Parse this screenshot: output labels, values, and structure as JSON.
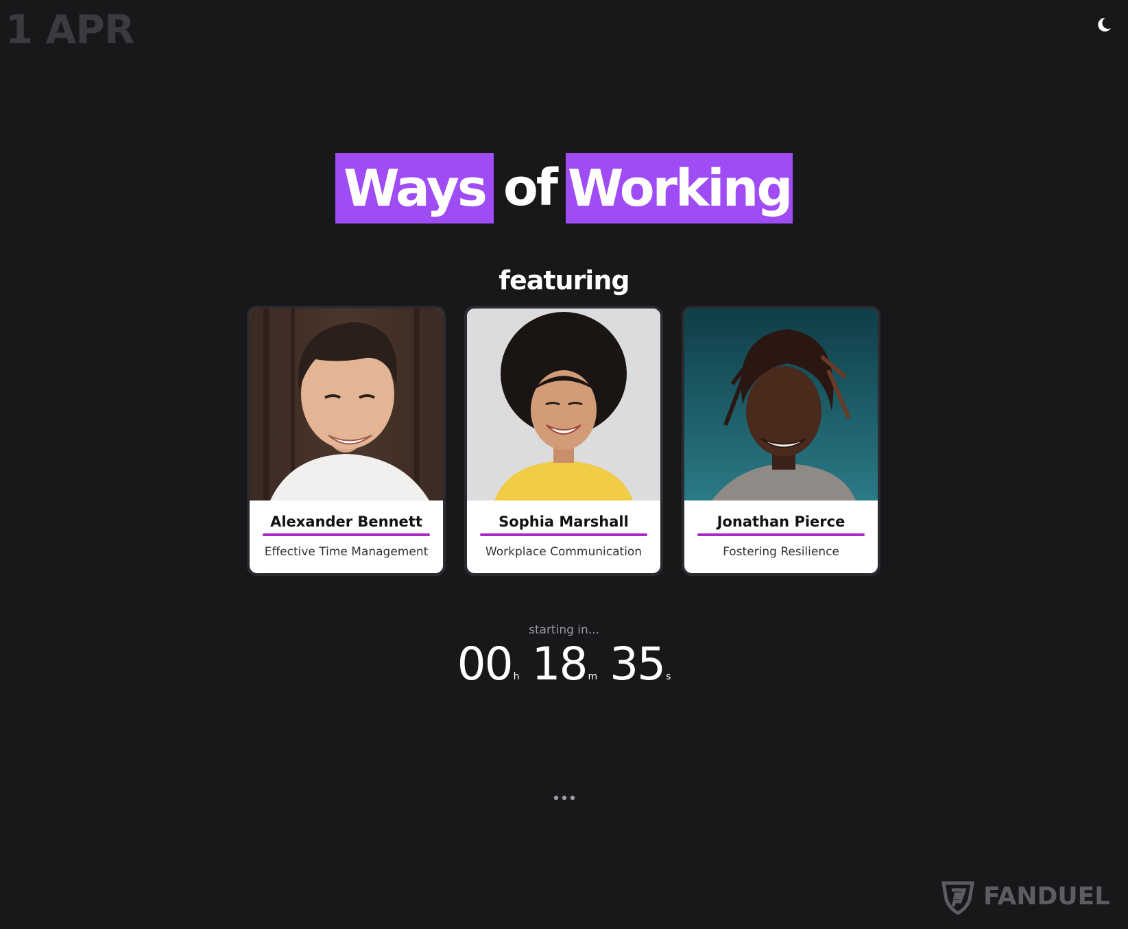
{
  "header": {
    "date": "1 APR",
    "theme_toggle_icon": "moon-icon"
  },
  "title": {
    "word_one": "Ways",
    "connector": "of",
    "word_two": "Working",
    "accent_color": "#a04cf5"
  },
  "featuring_label": "featuring",
  "speakers": [
    {
      "name": "Alexander Bennett",
      "topic": "Effective Time Management"
    },
    {
      "name": "Sophia Marshall",
      "topic": "Workplace Communication"
    },
    {
      "name": "Jonathan Pierce",
      "topic": "Fostering Resilience"
    }
  ],
  "countdown": {
    "label": "starting in...",
    "hours": "00",
    "hours_unit": "h",
    "minutes": "18",
    "minutes_unit": "m",
    "seconds": "35",
    "seconds_unit": "s"
  },
  "more_indicator": "•••",
  "brand": {
    "name": "FANDUEL",
    "logo_icon": "shield-logo-icon"
  },
  "colors": {
    "background": "#18181b",
    "rule": "#a829c9"
  }
}
